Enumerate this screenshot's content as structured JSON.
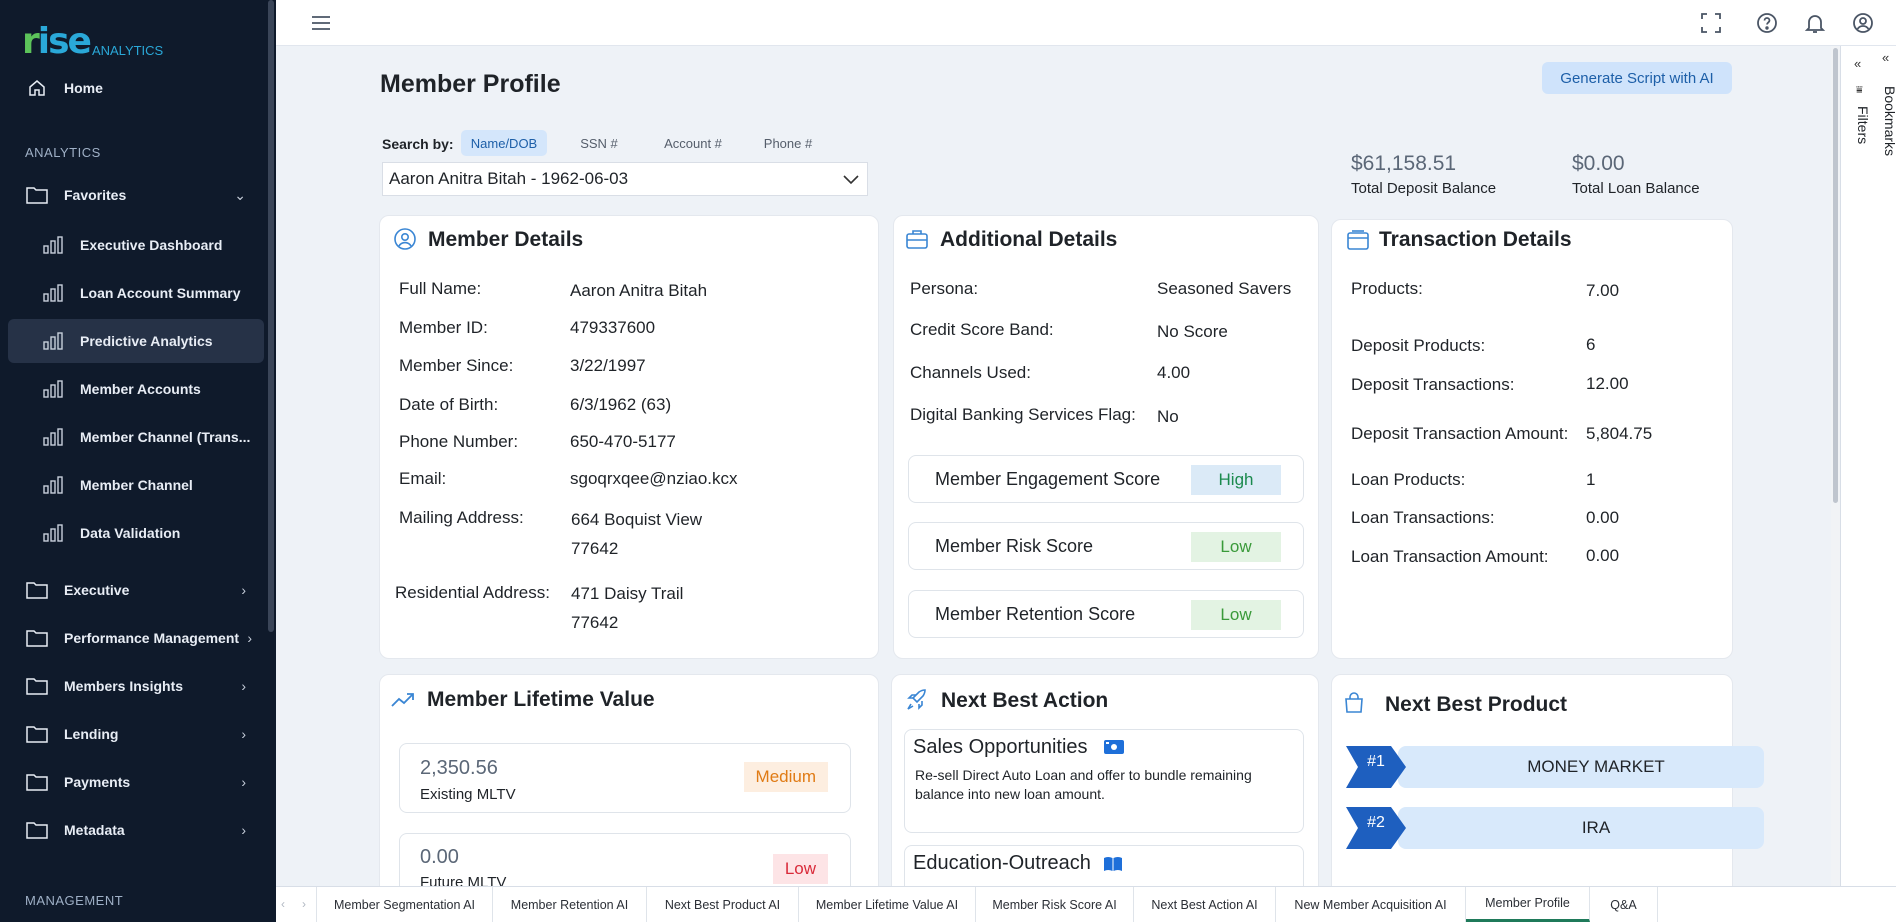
{
  "logo": {
    "brand": "rise",
    "sub": "ANALYTICS"
  },
  "sidebar": {
    "home": "Home",
    "analytics_label": "ANALYTICS",
    "favorites": "Favorites",
    "items": [
      "Executive Dashboard",
      "Loan Account Summary",
      "Predictive Analytics",
      "Member Accounts",
      "Member Channel (Trans...",
      "Member Channel",
      "Data Validation"
    ],
    "groups": [
      "Executive",
      "Performance Management",
      "Members Insights",
      "Lending",
      "Payments",
      "Metadata"
    ],
    "management_label": "MANAGEMENT"
  },
  "header": {
    "title": "Member Profile",
    "generate_btn": "Generate Script with AI"
  },
  "search": {
    "label": "Search by:",
    "tabs": [
      "Name/DOB",
      "SSN #",
      "Account #",
      "Phone #"
    ],
    "selected_tab": "Name/DOB",
    "value": "Aaron Anitra Bitah - 1962-06-03"
  },
  "balances": {
    "deposit_value": "$61,158.51",
    "deposit_label": "Total Deposit Balance",
    "loan_value": "$0.00",
    "loan_label": "Total Loan Balance"
  },
  "member_details": {
    "title": "Member Details",
    "full_name_label": "Full Name:",
    "full_name": "Aaron Anitra Bitah",
    "member_id_label": "Member ID:",
    "member_id": "479337600",
    "member_since_label": "Member Since:",
    "member_since": "3/22/1997",
    "dob_label": "Date of Birth:",
    "dob": "6/3/1962 (63)",
    "phone_label": "Phone Number:",
    "phone": "650-470-5177",
    "email_label": "Email:",
    "email": "sgoqrxqee@nziao.kcx",
    "mailing_label": "Mailing Address:",
    "mailing_line1": "664 Boquist View",
    "mailing_line2": "77642",
    "residential_label": "Residential Address:",
    "residential_line1": "471 Daisy Trail",
    "residential_line2": "77642"
  },
  "additional_details": {
    "title": "Additional Details",
    "persona_label": "Persona:",
    "persona": "Seasoned Savers",
    "credit_label": "Credit Score Band:",
    "credit": "No Score",
    "channels_label": "Channels Used:",
    "channels": "4.00",
    "digital_label": "Digital Banking Services Flag:",
    "digital": "No",
    "scores": [
      {
        "label": "Member Engagement Score",
        "value": "High"
      },
      {
        "label": "Member Risk Score",
        "value": "Low"
      },
      {
        "label": "Member Retention Score",
        "value": "Low"
      }
    ]
  },
  "transaction_details": {
    "title": "Transaction Details",
    "rows": [
      {
        "label": "Products:",
        "value": "7.00"
      },
      {
        "label": "Deposit Products:",
        "value": "6"
      },
      {
        "label": "Deposit Transactions:",
        "value": "12.00"
      },
      {
        "label": "Deposit Transaction Amount:",
        "value": "5,804.75"
      },
      {
        "label": "Loan Products:",
        "value": "1"
      },
      {
        "label": "Loan Transactions:",
        "value": "0.00"
      },
      {
        "label": "Loan Transaction Amount:",
        "value": "0.00"
      }
    ]
  },
  "mltv": {
    "title": "Member Lifetime Value",
    "existing_value": "2,350.56",
    "existing_label": "Existing MLTV",
    "existing_tag": "Medium",
    "future_value": "0.00",
    "future_label": "Future MLTV",
    "future_tag": "Low"
  },
  "nba": {
    "title": "Next Best Action",
    "sales_title": "Sales Opportunities",
    "sales_text": "Re-sell Direct Auto Loan and offer to bundle remaining balance into new loan amount.",
    "edu_title": "Education-Outreach"
  },
  "nbp": {
    "title": "Next Best Product",
    "items": [
      {
        "rank": "#1",
        "name": "MONEY MARKET"
      },
      {
        "rank": "#2",
        "name": "IRA"
      }
    ]
  },
  "right_pane": {
    "filters": "Filters",
    "bookmarks": "Bookmarks"
  },
  "tabs": [
    "Member Segmentation AI",
    "Member Retention AI",
    "Next Best Product AI",
    "Member Lifetime Value AI",
    "Member Risk Score AI",
    "Next Best Action AI",
    "New Member Acquisition AI",
    "Member Profile",
    "Q&A"
  ],
  "selected_tab": "Member Profile",
  "colors": {
    "sidebar_bg": "#0f1a2b",
    "accent": "#1d5fa8",
    "tab_underline": "#1f7a5a"
  }
}
